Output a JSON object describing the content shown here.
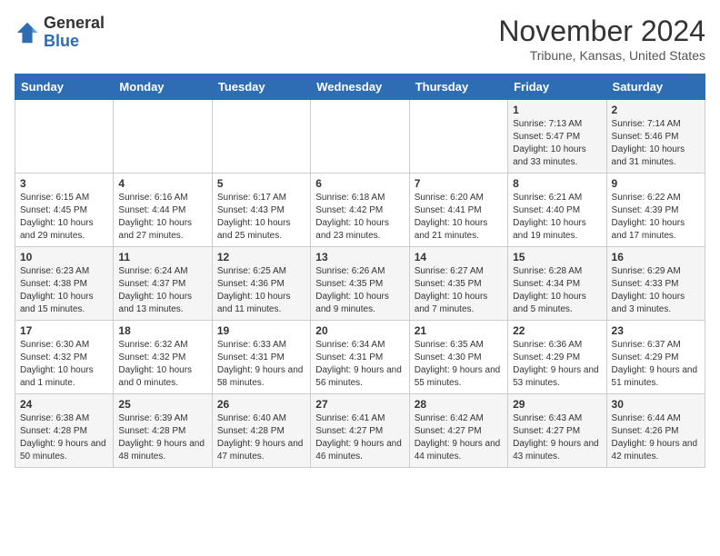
{
  "app": {
    "name_general": "General",
    "name_blue": "Blue"
  },
  "title": "November 2024",
  "subtitle": "Tribune, Kansas, United States",
  "days_of_week": [
    "Sunday",
    "Monday",
    "Tuesday",
    "Wednesday",
    "Thursday",
    "Friday",
    "Saturday"
  ],
  "weeks": [
    [
      {
        "day": "",
        "info": ""
      },
      {
        "day": "",
        "info": ""
      },
      {
        "day": "",
        "info": ""
      },
      {
        "day": "",
        "info": ""
      },
      {
        "day": "",
        "info": ""
      },
      {
        "day": "1",
        "info": "Sunrise: 7:13 AM\nSunset: 5:47 PM\nDaylight: 10 hours and 33 minutes."
      },
      {
        "day": "2",
        "info": "Sunrise: 7:14 AM\nSunset: 5:46 PM\nDaylight: 10 hours and 31 minutes."
      }
    ],
    [
      {
        "day": "3",
        "info": "Sunrise: 6:15 AM\nSunset: 4:45 PM\nDaylight: 10 hours and 29 minutes."
      },
      {
        "day": "4",
        "info": "Sunrise: 6:16 AM\nSunset: 4:44 PM\nDaylight: 10 hours and 27 minutes."
      },
      {
        "day": "5",
        "info": "Sunrise: 6:17 AM\nSunset: 4:43 PM\nDaylight: 10 hours and 25 minutes."
      },
      {
        "day": "6",
        "info": "Sunrise: 6:18 AM\nSunset: 4:42 PM\nDaylight: 10 hours and 23 minutes."
      },
      {
        "day": "7",
        "info": "Sunrise: 6:20 AM\nSunset: 4:41 PM\nDaylight: 10 hours and 21 minutes."
      },
      {
        "day": "8",
        "info": "Sunrise: 6:21 AM\nSunset: 4:40 PM\nDaylight: 10 hours and 19 minutes."
      },
      {
        "day": "9",
        "info": "Sunrise: 6:22 AM\nSunset: 4:39 PM\nDaylight: 10 hours and 17 minutes."
      }
    ],
    [
      {
        "day": "10",
        "info": "Sunrise: 6:23 AM\nSunset: 4:38 PM\nDaylight: 10 hours and 15 minutes."
      },
      {
        "day": "11",
        "info": "Sunrise: 6:24 AM\nSunset: 4:37 PM\nDaylight: 10 hours and 13 minutes."
      },
      {
        "day": "12",
        "info": "Sunrise: 6:25 AM\nSunset: 4:36 PM\nDaylight: 10 hours and 11 minutes."
      },
      {
        "day": "13",
        "info": "Sunrise: 6:26 AM\nSunset: 4:35 PM\nDaylight: 10 hours and 9 minutes."
      },
      {
        "day": "14",
        "info": "Sunrise: 6:27 AM\nSunset: 4:35 PM\nDaylight: 10 hours and 7 minutes."
      },
      {
        "day": "15",
        "info": "Sunrise: 6:28 AM\nSunset: 4:34 PM\nDaylight: 10 hours and 5 minutes."
      },
      {
        "day": "16",
        "info": "Sunrise: 6:29 AM\nSunset: 4:33 PM\nDaylight: 10 hours and 3 minutes."
      }
    ],
    [
      {
        "day": "17",
        "info": "Sunrise: 6:30 AM\nSunset: 4:32 PM\nDaylight: 10 hours and 1 minute."
      },
      {
        "day": "18",
        "info": "Sunrise: 6:32 AM\nSunset: 4:32 PM\nDaylight: 10 hours and 0 minutes."
      },
      {
        "day": "19",
        "info": "Sunrise: 6:33 AM\nSunset: 4:31 PM\nDaylight: 9 hours and 58 minutes."
      },
      {
        "day": "20",
        "info": "Sunrise: 6:34 AM\nSunset: 4:31 PM\nDaylight: 9 hours and 56 minutes."
      },
      {
        "day": "21",
        "info": "Sunrise: 6:35 AM\nSunset: 4:30 PM\nDaylight: 9 hours and 55 minutes."
      },
      {
        "day": "22",
        "info": "Sunrise: 6:36 AM\nSunset: 4:29 PM\nDaylight: 9 hours and 53 minutes."
      },
      {
        "day": "23",
        "info": "Sunrise: 6:37 AM\nSunset: 4:29 PM\nDaylight: 9 hours and 51 minutes."
      }
    ],
    [
      {
        "day": "24",
        "info": "Sunrise: 6:38 AM\nSunset: 4:28 PM\nDaylight: 9 hours and 50 minutes."
      },
      {
        "day": "25",
        "info": "Sunrise: 6:39 AM\nSunset: 4:28 PM\nDaylight: 9 hours and 48 minutes."
      },
      {
        "day": "26",
        "info": "Sunrise: 6:40 AM\nSunset: 4:28 PM\nDaylight: 9 hours and 47 minutes."
      },
      {
        "day": "27",
        "info": "Sunrise: 6:41 AM\nSunset: 4:27 PM\nDaylight: 9 hours and 46 minutes."
      },
      {
        "day": "28",
        "info": "Sunrise: 6:42 AM\nSunset: 4:27 PM\nDaylight: 9 hours and 44 minutes."
      },
      {
        "day": "29",
        "info": "Sunrise: 6:43 AM\nSunset: 4:27 PM\nDaylight: 9 hours and 43 minutes."
      },
      {
        "day": "30",
        "info": "Sunrise: 6:44 AM\nSunset: 4:26 PM\nDaylight: 9 hours and 42 minutes."
      }
    ]
  ]
}
